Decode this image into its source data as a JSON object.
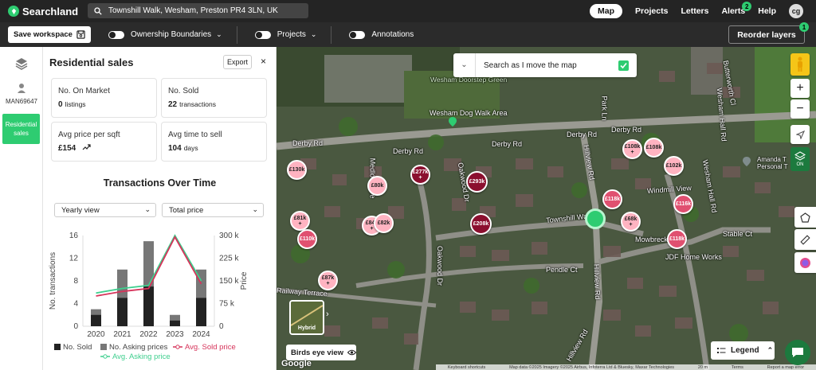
{
  "topbar": {
    "brand": "Searchland",
    "search_value": "Townshill Walk, Wesham, Preston PR4 3LN, UK",
    "nav": {
      "map": "Map",
      "projects": "Projects",
      "letters": "Letters",
      "alerts": "Alerts",
      "alerts_count": "2",
      "help": "Help",
      "avatar": "cg"
    }
  },
  "subbar": {
    "save_workspace": "Save workspace",
    "ownership": "Ownership Boundaries",
    "projects": "Projects",
    "annotations": "Annotations",
    "reorder": "Reorder layers",
    "reorder_count": "1"
  },
  "leftnav": {
    "user_label": "MAN69647",
    "active_label": "Residential sales"
  },
  "panel": {
    "title": "Residential sales",
    "export": "Export",
    "close": "×",
    "cards": [
      {
        "label": "No. On Market",
        "value": "0",
        "unit": "listings"
      },
      {
        "label": "No. Sold",
        "value": "22",
        "unit": "transactions"
      },
      {
        "label": "Avg price per sqft",
        "value": "£154",
        "unit": ""
      },
      {
        "label": "Avg time to sell",
        "value": "104",
        "unit": "days"
      }
    ],
    "chart_title": "Transactions Over Time",
    "view_select": "Yearly view",
    "price_select": "Total price"
  },
  "chart_data": {
    "type": "bar",
    "categories": [
      "2020",
      "2021",
      "2022",
      "2023",
      "2024"
    ],
    "series": [
      {
        "name": "No. Sold",
        "kind": "bar",
        "axis": "left",
        "color": "#222222",
        "values": [
          2,
          5,
          7,
          1,
          5
        ]
      },
      {
        "name": "No. Asking prices",
        "kind": "bar",
        "axis": "left",
        "color": "#777777",
        "values": [
          1,
          5,
          8,
          1,
          5
        ]
      },
      {
        "name": "Avg. Sold price",
        "kind": "line",
        "axis": "right",
        "color": "#d6335a",
        "values": [
          100000,
          115000,
          125000,
          295000,
          140000
        ]
      },
      {
        "name": "Avg. Asking price",
        "kind": "line",
        "axis": "right",
        "color": "#3ecf8e",
        "values": [
          110000,
          125000,
          135000,
          300000,
          150000
        ]
      }
    ],
    "ylabel": "No. transactions",
    "y2label": "Price",
    "ylim": [
      0,
      16
    ],
    "y2lim": [
      0,
      300000
    ],
    "yticks": [
      "0",
      "4",
      "8",
      "12",
      "16"
    ],
    "y2ticks": [
      "0",
      "75 k",
      "150 k",
      "225 k",
      "300 k"
    ],
    "legend_position": "bottom"
  },
  "map": {
    "search_move": "Search as I move the map",
    "hybrid": "Hybrid",
    "birds_eye": "Birds eye view",
    "legend": "Legend",
    "google": "Google",
    "on_label": "ON",
    "attribution": [
      "Keyboard shortcuts",
      "Map data ©2025 Imagery ©2025 Airbus, Infoterra Ltd & Bluesky, Maxar Technologies",
      "20 m",
      "Terms",
      "Report a map error"
    ],
    "streets": [
      "Derby Rd",
      "Derby Rd",
      "Derby Rd",
      "Derby Rd",
      "Derby Rd",
      "Wesham Dog Walk Area",
      "Wesham Doorstep Green",
      "Park Ln",
      "Hillview Rd",
      "Hillview Rd",
      "Hillview Rd",
      "Oakwood Dr",
      "Oakwood Dr",
      "Townshill Walk",
      "Mowbreck Ct",
      "Pendle Ct",
      "Windmill View",
      "Wesham Hall Rd",
      "Wesham Hall Rd",
      "Stable Ct",
      "JDF Home Works",
      "Amanda T Personal T",
      "Butterworth Cl",
      "Railway Terrace",
      "Medlock Ave"
    ],
    "pins": [
      {
        "label": "£130k",
        "tone": "light",
        "plus": false
      },
      {
        "label": "£80k",
        "tone": "light",
        "plus": false
      },
      {
        "label": "£277k",
        "tone": "dark",
        "plus": true
      },
      {
        "label": "£293k",
        "tone": "dark",
        "plus": false
      },
      {
        "label": "£81k",
        "tone": "light",
        "plus": true
      },
      {
        "label": "£110k",
        "tone": "mid",
        "plus": false
      },
      {
        "label": "£84k",
        "tone": "light",
        "plus": true
      },
      {
        "label": "£82k",
        "tone": "light",
        "plus": false
      },
      {
        "label": "£208k",
        "tone": "dark",
        "plus": false
      },
      {
        "label": "£87k",
        "tone": "light",
        "plus": true
      },
      {
        "label": "£108k",
        "tone": "light",
        "plus": true
      },
      {
        "label": "£108k",
        "tone": "light",
        "plus": false
      },
      {
        "label": "£102k",
        "tone": "light",
        "plus": false
      },
      {
        "label": "£118k",
        "tone": "mid",
        "plus": false
      },
      {
        "label": "£116k",
        "tone": "mid",
        "plus": false
      },
      {
        "label": "£68k",
        "tone": "light",
        "plus": true
      },
      {
        "label": "£118k",
        "tone": "mid",
        "plus": false
      }
    ]
  }
}
